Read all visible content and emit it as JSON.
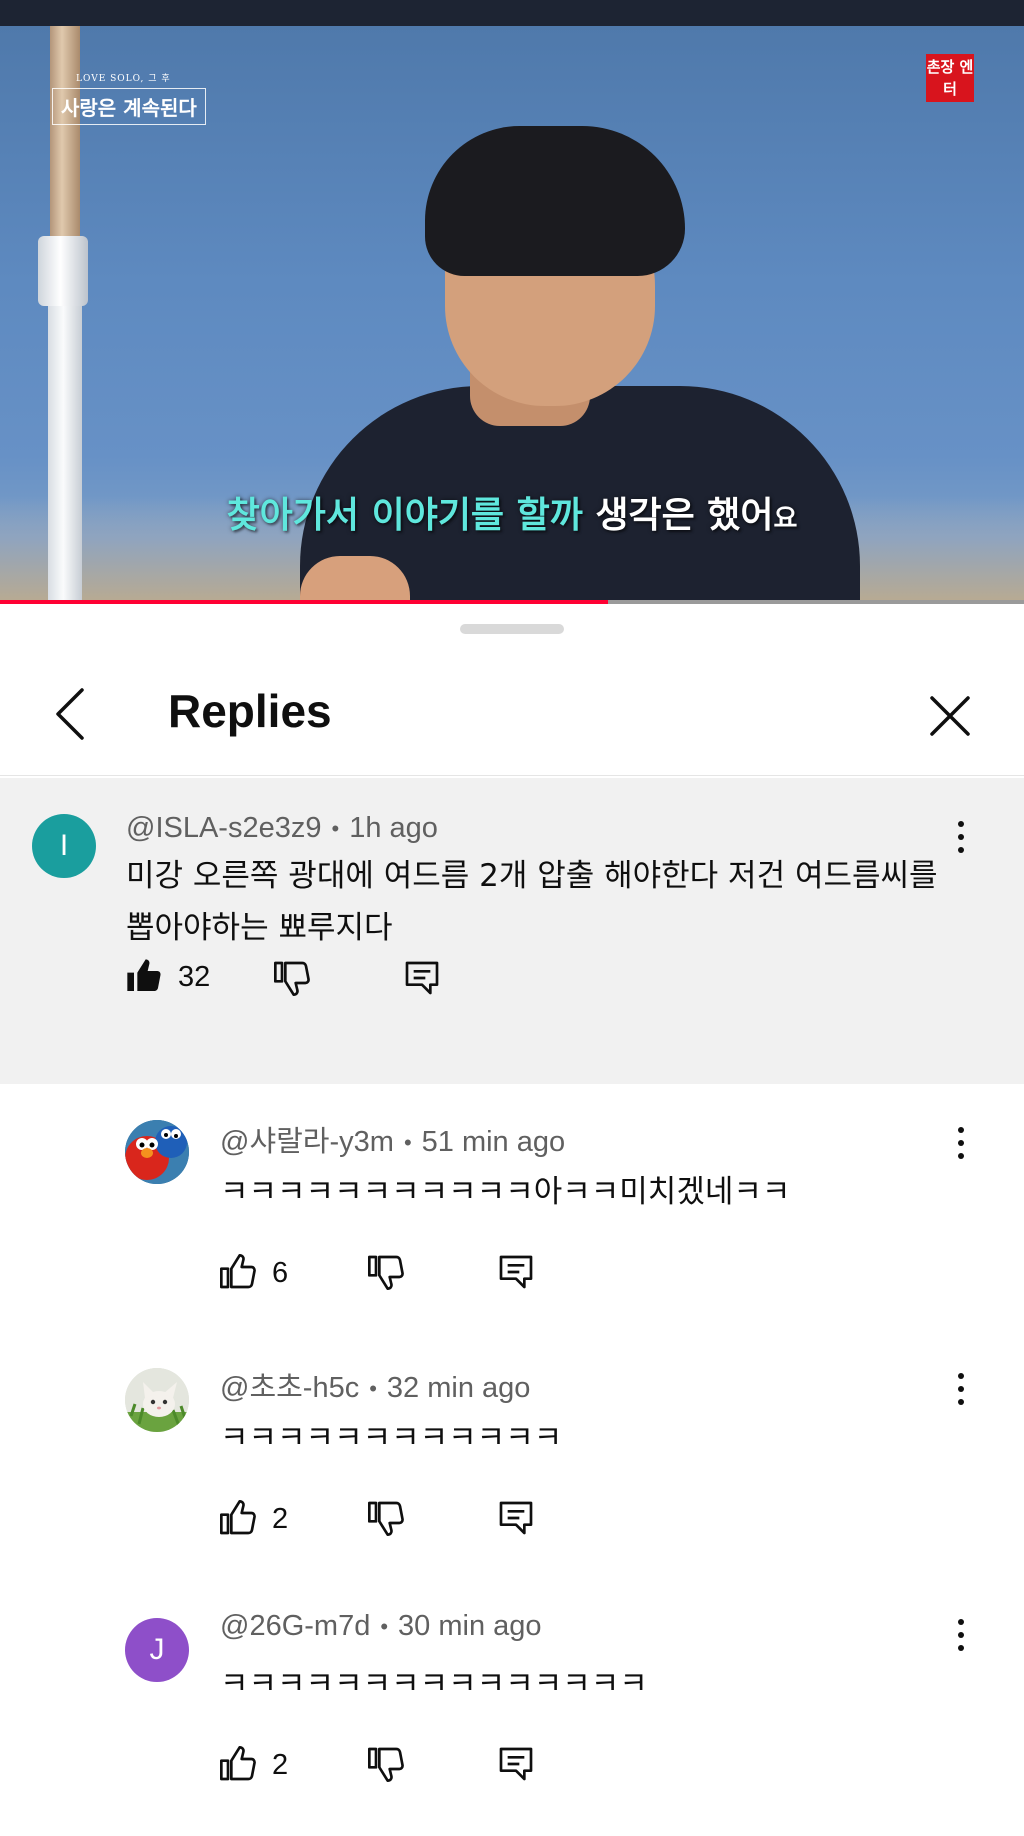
{
  "video": {
    "show_title_small": "LOVE SOLO, 그 후",
    "show_title": "사랑은 계속된다",
    "channel_logo": "촌장 엔터",
    "subtitle_highlight": "찾아가서 이야기를 할까",
    "subtitle_rest": " 생각은 했어",
    "subtitle_end": "요",
    "progress_fraction": 0.594
  },
  "header": {
    "title": "Replies"
  },
  "main_comment": {
    "avatar_letter": "I",
    "avatar_color": "#1a9e9e",
    "author": "@ISLA-s2e3z9",
    "time": "1h ago",
    "text": "미강 오른쪽 광대에 여드름 2개 압출 해야한다 저건 여드름씨를 뽑아야하는 뾰루지다",
    "likes": "32"
  },
  "replies": [
    {
      "author": "@샤랄라-y3m",
      "time": "51 min ago",
      "text": "ㅋㅋㅋㅋㅋㅋㅋㅋㅋㅋㅋ아ㅋㅋ미치겠네ㅋㅋ",
      "likes": "6",
      "avatar": "elmo-cookie-monster-image"
    },
    {
      "author": "@초초-h5c",
      "time": "32 min ago",
      "text": "ㅋㅋㅋㅋㅋㅋㅋㅋㅋㅋㅋㅋ",
      "likes": "2",
      "avatar": "kitten-image"
    },
    {
      "author": "@26G-m7d",
      "time": "30 min ago",
      "text": "ㅋㅋㅋㅋㅋㅋㅋㅋㅋㅋㅋㅋㅋㅋㅋ",
      "likes": "2",
      "avatar_letter": "J",
      "avatar_color": "#8e4fc9"
    }
  ],
  "colors": {
    "progress_played": "#ff0033",
    "subtitle_highlight": "#5fe7dd"
  }
}
